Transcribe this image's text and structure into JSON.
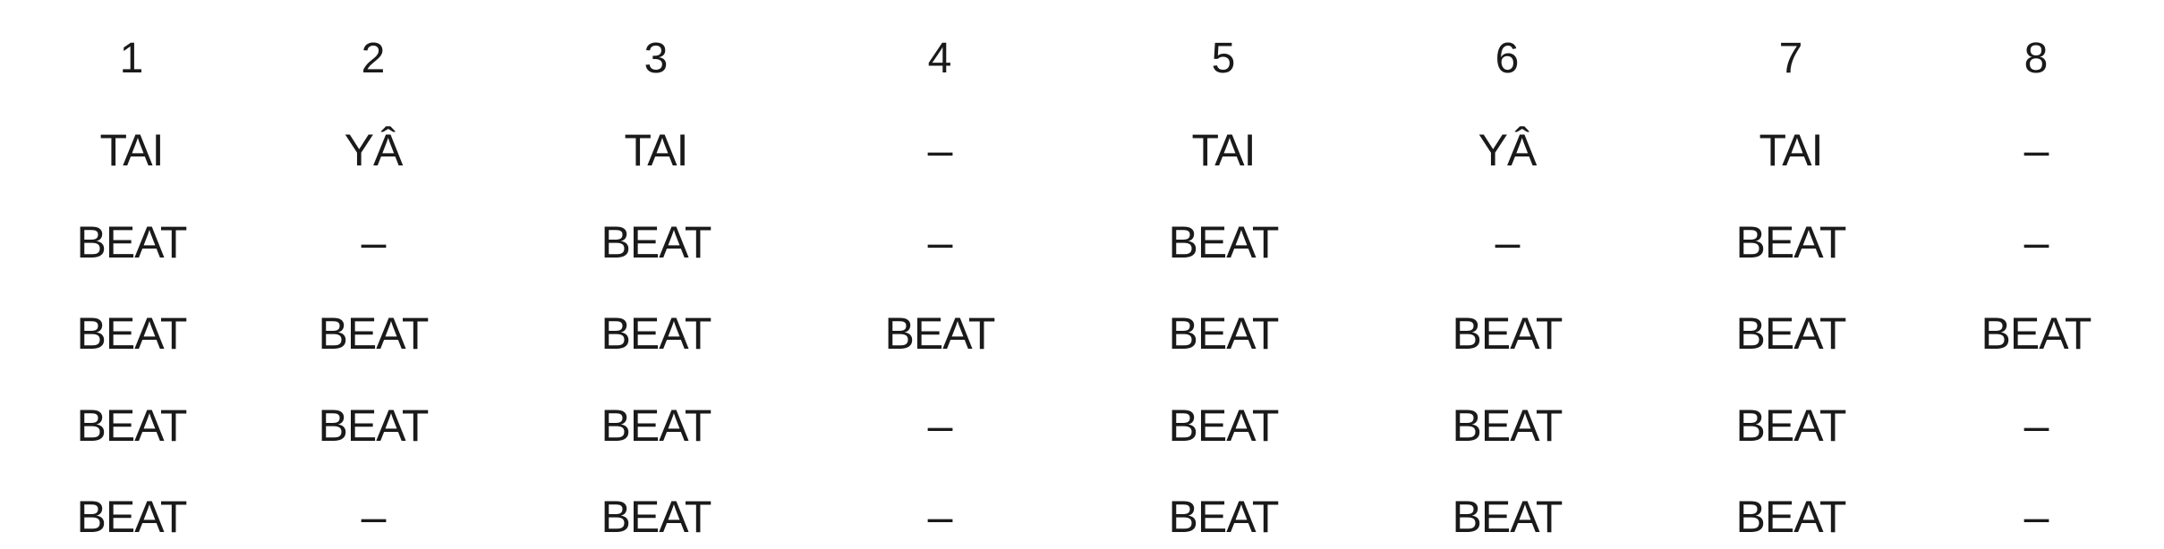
{
  "header": [
    "1",
    "2",
    "3",
    "4",
    "5",
    "6",
    "7",
    "8"
  ],
  "rows": [
    [
      "TAI",
      "YÂ",
      "TAI",
      "–",
      "TAI",
      "YÂ",
      "TAI",
      "–"
    ],
    [
      "BEAT",
      "–",
      "BEAT",
      "–",
      "BEAT",
      "–",
      "BEAT",
      "–"
    ],
    [
      "BEAT",
      "BEAT",
      "BEAT",
      "BEAT",
      "BEAT",
      "BEAT",
      "BEAT",
      "BEAT"
    ],
    [
      "BEAT",
      "BEAT",
      "BEAT",
      "–",
      "BEAT",
      "BEAT",
      "BEAT",
      "–"
    ],
    [
      "BEAT",
      "–",
      "BEAT",
      "–",
      "BEAT",
      "BEAT",
      "BEAT",
      "–"
    ]
  ]
}
